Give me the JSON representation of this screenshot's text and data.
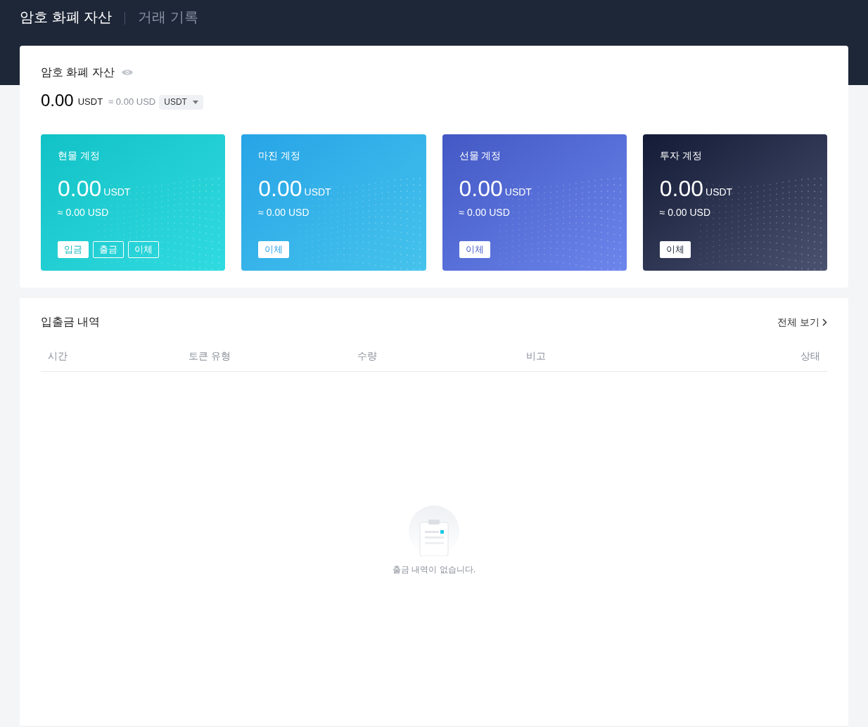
{
  "header_tabs": [
    {
      "label": "암호 화폐 자산",
      "selected": true
    },
    {
      "label": "거래 기록",
      "selected": false
    }
  ],
  "assets": {
    "title": "암호 화폐 자산",
    "total": "0.00",
    "total_unit": "USDT",
    "approx": "≈ 0.00 USD",
    "currency_select": "USDT"
  },
  "accounts": [
    {
      "name": "현물 계정",
      "amount": "0.00",
      "unit": "USDT",
      "approx": "≈ 0.00 USD",
      "buttons": [
        {
          "label": "입금",
          "kind": "filled"
        },
        {
          "label": "출금",
          "kind": "outline"
        },
        {
          "label": "이체",
          "kind": "outline"
        }
      ]
    },
    {
      "name": "마진 계정",
      "amount": "0.00",
      "unit": "USDT",
      "approx": "≈ 0.00 USD",
      "buttons": [
        {
          "label": "이체",
          "kind": "filled"
        }
      ]
    },
    {
      "name": "선물 계정",
      "amount": "0.00",
      "unit": "USDT",
      "approx": "≈ 0.00 USD",
      "buttons": [
        {
          "label": "이체",
          "kind": "filled"
        }
      ]
    },
    {
      "name": "투자 계정",
      "amount": "0.00",
      "unit": "USDT",
      "approx": "≈ 0.00 USD",
      "buttons": [
        {
          "label": "이체",
          "kind": "filled"
        }
      ]
    }
  ],
  "history": {
    "title": "입출금 내역",
    "view_all": "전체 보기",
    "columns": [
      "시간",
      "토큰 유형",
      "수량",
      "비고",
      "상태"
    ],
    "empty_message": "출금 내역이 없습니다."
  }
}
